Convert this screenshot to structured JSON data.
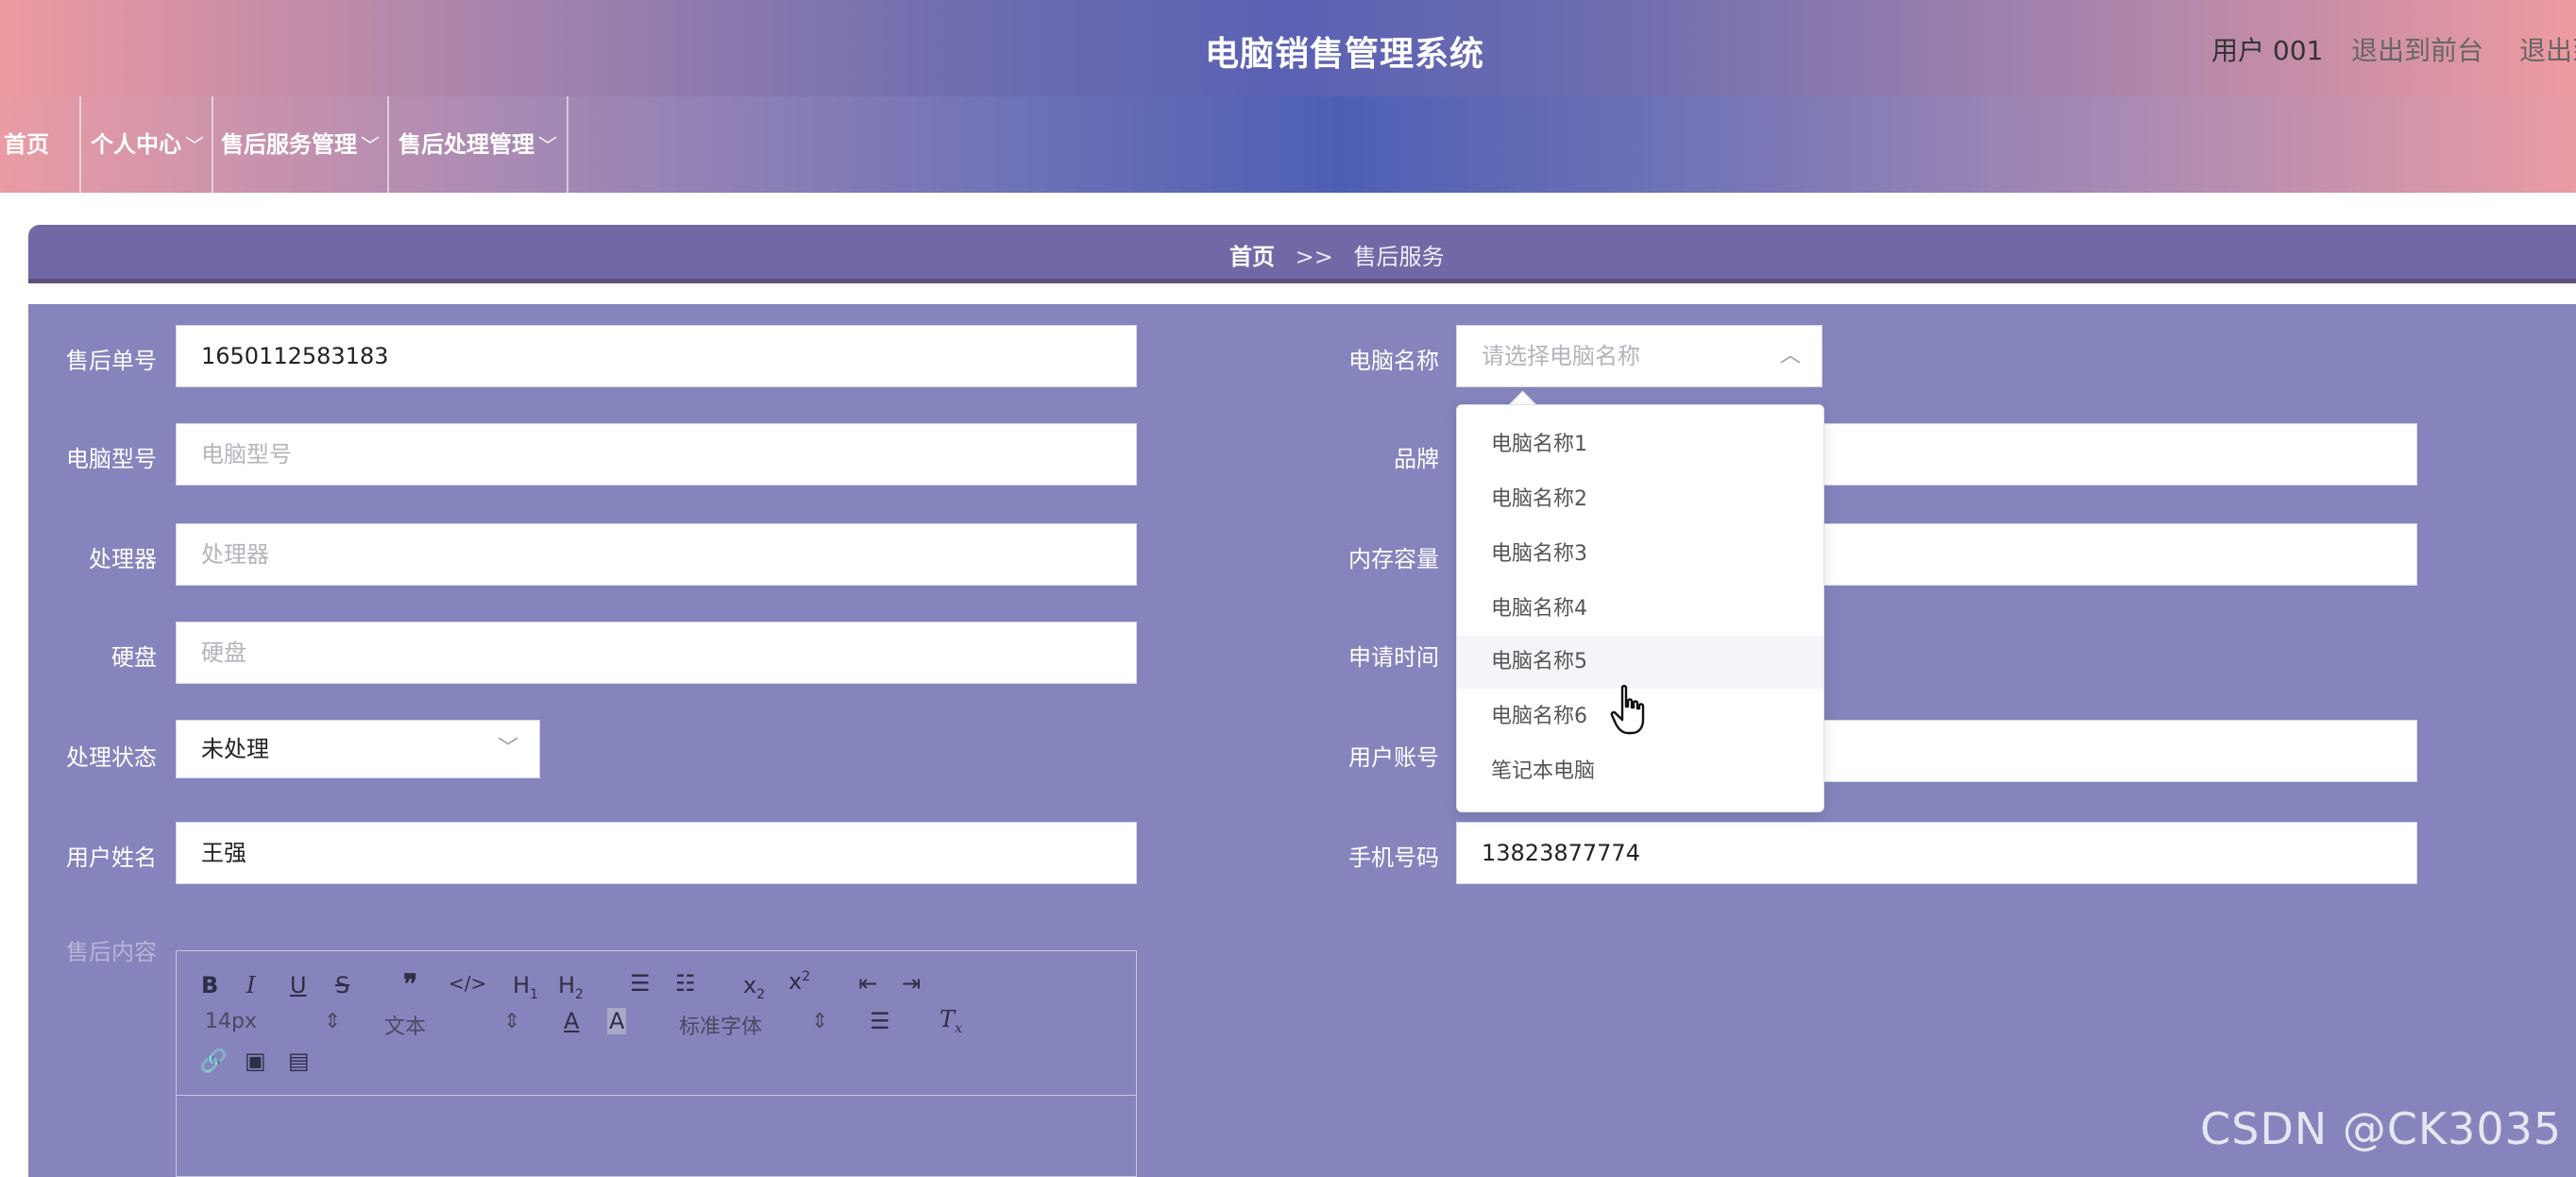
{
  "header": {
    "title": "电脑销售管理系统",
    "user_label": "用户 001",
    "exit_front": "退出到前台",
    "exit_system": "退出到"
  },
  "nav": {
    "items": [
      {
        "label": "首页",
        "has_dropdown": false
      },
      {
        "label": "个人中心",
        "has_dropdown": true
      },
      {
        "label": "售后服务管理",
        "has_dropdown": true
      },
      {
        "label": "售后处理管理",
        "has_dropdown": true
      }
    ],
    "chevron_icon": "chevron-down-icon"
  },
  "breadcrumb": {
    "home": "首页",
    "separator": ">>",
    "current": "售后服务"
  },
  "form": {
    "order_no": {
      "label": "售后单号",
      "value": "1650112583183"
    },
    "computer_name": {
      "label": "电脑名称",
      "placeholder": "请选择电脑名称"
    },
    "model": {
      "label": "电脑型号",
      "placeholder": "电脑型号"
    },
    "brand": {
      "label": "品牌"
    },
    "cpu": {
      "label": "处理器",
      "placeholder": "处理器"
    },
    "memory": {
      "label": "内存容量"
    },
    "disk": {
      "label": "硬盘",
      "placeholder": "硬盘"
    },
    "apply_time": {
      "label": "申请时间"
    },
    "status": {
      "label": "处理状态",
      "value": "未处理"
    },
    "account": {
      "label": "用户账号"
    },
    "user_name": {
      "label": "用户姓名",
      "value": "王强"
    },
    "phone": {
      "label": "手机号码",
      "value": "13823877774"
    },
    "content": {
      "label": "售后内容"
    }
  },
  "editor": {
    "font_size": "14px",
    "paragraph": "文本",
    "font_family": "标准字体"
  },
  "dropdown": {
    "options": [
      "电脑名称1",
      "电脑名称2",
      "电脑名称3",
      "电脑名称4",
      "电脑名称5",
      "电脑名称6",
      "笔记本电脑"
    ],
    "hovered": "电脑名称5"
  },
  "watermark": "CSDN @CK3035",
  "colors": {
    "form_background": "#8584bd",
    "breadcrumb_background": "#7169a5",
    "header_gradient_center": "#5a61b3",
    "header_gradient_edge": "#ee9aa0"
  }
}
